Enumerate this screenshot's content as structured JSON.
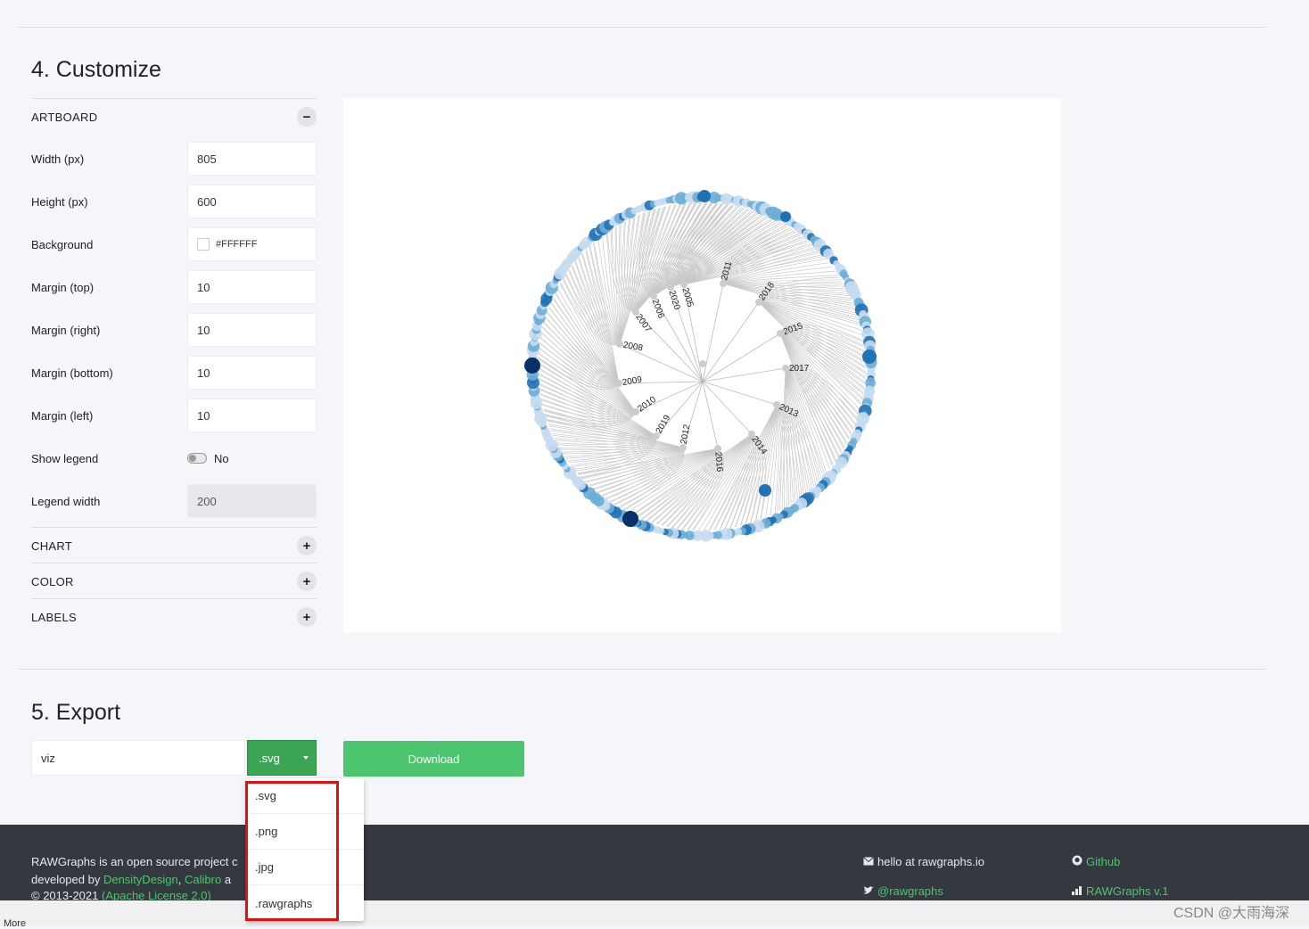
{
  "customize": {
    "title": "4. Customize",
    "artboard_head": "ARTBOARD",
    "collapse_symbol": "−",
    "expand_symbol": "+",
    "fields": {
      "width": {
        "label": "Width (px)",
        "value": "805"
      },
      "height": {
        "label": "Height (px)",
        "value": "600"
      },
      "background": {
        "label": "Background",
        "value": "#FFFFFF"
      },
      "margin_top": {
        "label": "Margin (top)",
        "value": "10"
      },
      "margin_right": {
        "label": "Margin (right)",
        "value": "10"
      },
      "margin_bottom": {
        "label": "Margin (bottom)",
        "value": "10"
      },
      "margin_left": {
        "label": "Margin (left)",
        "value": "10"
      },
      "show_legend": {
        "label": "Show legend",
        "value": "No"
      },
      "legend_width": {
        "label": "Legend width",
        "value": "200"
      }
    },
    "groups": [
      "CHART",
      "COLOR",
      "LABELS"
    ]
  },
  "chart": {
    "year_labels": [
      "2005",
      "2020",
      "2006",
      "2007",
      "2011",
      "2018",
      "2015",
      "2017",
      "2013",
      "2014",
      "2016",
      "2012",
      "2019",
      "2010",
      "2009",
      "2008"
    ],
    "colors": {
      "link": "#c8c8c8",
      "node_light": "#c6dbef",
      "node_mid": "#6baed6",
      "node_dark": "#2171b5",
      "node_darkest": "#08306b",
      "hub": "#cccccc"
    }
  },
  "export": {
    "title": "5. Export",
    "filename": "viz",
    "format": ".svg",
    "download_label": "Download",
    "options": [
      ".svg",
      ".png",
      ".jpg",
      ".rawgraphs"
    ]
  },
  "footer": {
    "text1": "RAWGraphs is an open source project c",
    "text2_prefix": "developed by ",
    "link_densitydesign": "DensityDesign",
    "comma": ", ",
    "link_calibro": "Calibro",
    "text2_suffix": " a",
    "text3_prefix": "© 2013-2021 ",
    "link_license": "(Apache License 2.0)",
    "email": "hello at rawgraphs.io",
    "twitter": "@rawgraphs",
    "github": "Github",
    "version": "RAWGraphs v.1",
    "more": "More"
  },
  "watermark": "CSDN @大雨海深"
}
